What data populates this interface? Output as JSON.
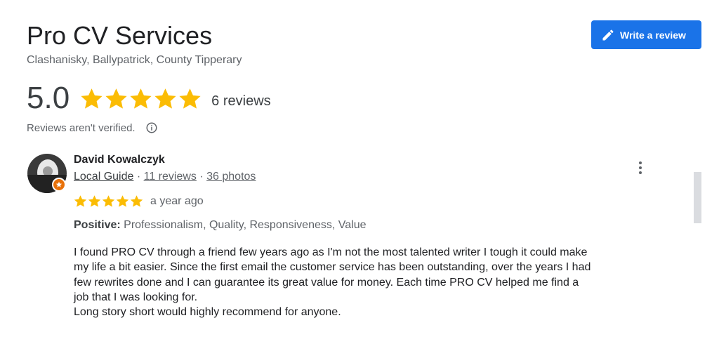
{
  "business": {
    "name": "Pro CV Services",
    "address": "Clashanisky, Ballypatrick, County Tipperary"
  },
  "write_review": {
    "label": "Write a review",
    "icon": "pencil-icon"
  },
  "summary": {
    "rating": "5.0",
    "stars": 5,
    "review_count": "6 reviews",
    "verification_note": "Reviews aren't verified.",
    "info_icon": "info-icon"
  },
  "colors": {
    "star": "#fbbc04",
    "button": "#1a73e8",
    "badge": "#e8710a"
  },
  "review": {
    "author": "David Kowalczyk",
    "badge_icon": "local-guide-badge-icon",
    "local_guide": "Local Guide",
    "sep1": " · ",
    "reviews": "11 reviews",
    "sep2": " · ",
    "photos": "36 photos",
    "stars": 5,
    "time": "a year ago",
    "positive_label": "Positive:",
    "positive_values": "Professionalism, Quality, Responsiveness, Value",
    "text_lines": [
      "I found PRO CV through a friend few years ago as I'm not the most talented writer I tough it could make",
      "my life a bit easier. Since the first email the customer service has been outstanding, over the years I had",
      "few rewrites done and I can guarantee its great value for money. Each time PRO CV helped me find a",
      "job that I was looking for.",
      "Long story short would highly recommend for anyone."
    ]
  }
}
